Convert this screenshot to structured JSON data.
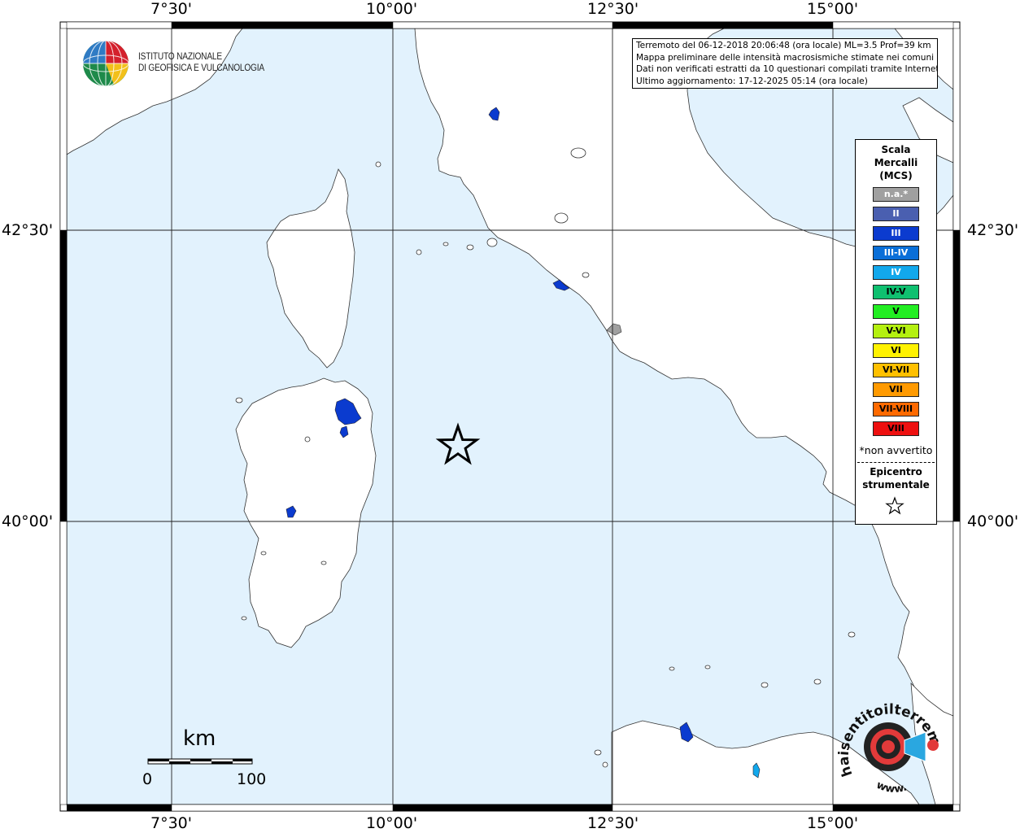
{
  "map": {
    "longitude_labels": [
      "7°30'",
      "10°00'",
      "12°30'",
      "15°00'"
    ],
    "latitude_labels": [
      "42°30'",
      "40°00'"
    ],
    "colors": {
      "sea": "#e2f2fd",
      "land": "#ffffff",
      "frame": "#000000"
    }
  },
  "info": {
    "line1": "Terremoto del 06-12-2018 20:06:48 (ora locale) ML=3.5 Prof=39 km",
    "line2": "Mappa preliminare delle intensità macrosismiche stimate nei comuni",
    "line3": "Dati non verificati estratti da 10 questionari compilati tramite Internet.",
    "line4": "Ultimo aggiornamento: 17-12-2025 05:14 (ora locale)"
  },
  "logo": {
    "line1": "ISTITUTO NAZIONALE",
    "line2": "DI GEOFISICA E VULCANOLOGIA"
  },
  "legend": {
    "title1": "Scala",
    "title2": "Mercalli",
    "title3": "(MCS)",
    "items": [
      {
        "label": "n.a.*",
        "color": "#a0a0a0",
        "text_color": "#ffffff"
      },
      {
        "label": "II",
        "color": "#4a5fb0",
        "text_color": "#ffffff"
      },
      {
        "label": "III",
        "color": "#0b3bcf",
        "text_color": "#ffffff"
      },
      {
        "label": "III-IV",
        "color": "#0a6fd8",
        "text_color": "#ffffff"
      },
      {
        "label": "IV",
        "color": "#12a8ec",
        "text_color": "#ffffff"
      },
      {
        "label": "IV-V",
        "color": "#0fc070",
        "text_color": "#000000"
      },
      {
        "label": "V",
        "color": "#22ee22",
        "text_color": "#000000"
      },
      {
        "label": "V-VI",
        "color": "#b4f010",
        "text_color": "#000000"
      },
      {
        "label": "VI",
        "color": "#fff200",
        "text_color": "#000000"
      },
      {
        "label": "VI-VII",
        "color": "#ffc000",
        "text_color": "#000000"
      },
      {
        "label": "VII",
        "color": "#ff9a00",
        "text_color": "#000000"
      },
      {
        "label": "VII-VIII",
        "color": "#ff6a00",
        "text_color": "#000000"
      },
      {
        "label": "VIII",
        "color": "#ee1010",
        "text_color": "#000000"
      }
    ],
    "note": "*non avvertito",
    "epicentre1": "Epicentro",
    "epicentre2": "strumentale"
  },
  "scale_bar": {
    "unit": "km",
    "min_label": "0",
    "max_label": "100"
  },
  "site_logo": {
    "text": "haisentitoilterremoto.it",
    "sub": "www."
  }
}
